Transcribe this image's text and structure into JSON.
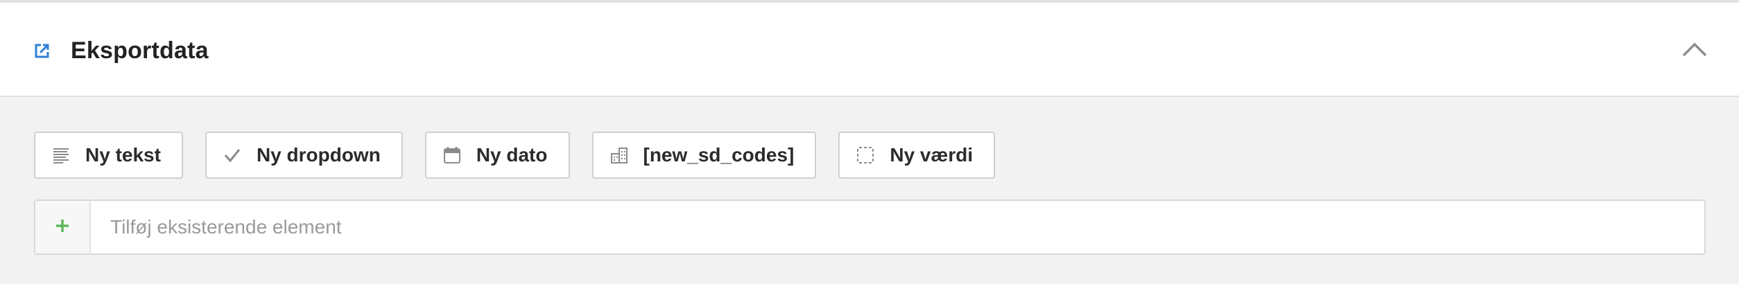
{
  "panel": {
    "title": "Eksportdata",
    "icon": "export-icon",
    "collapse_icon": "chevron-up-icon"
  },
  "toolbar": {
    "buttons": [
      {
        "label": "Ny tekst",
        "icon": "text-lines-icon"
      },
      {
        "label": "Ny dropdown",
        "icon": "checkmark-icon"
      },
      {
        "label": "Ny dato",
        "icon": "calendar-icon"
      },
      {
        "label": "[new_sd_codes]",
        "icon": "building-icon"
      },
      {
        "label": "Ny værdi",
        "icon": "dashed-square-icon"
      }
    ]
  },
  "add_element": {
    "placeholder": "Tilføj eksisterende element",
    "icon": "plus-icon"
  },
  "colors": {
    "accent_blue": "#2f80d6",
    "plus_green": "#5cb85c",
    "icon_gray": "#9a9a9a"
  }
}
